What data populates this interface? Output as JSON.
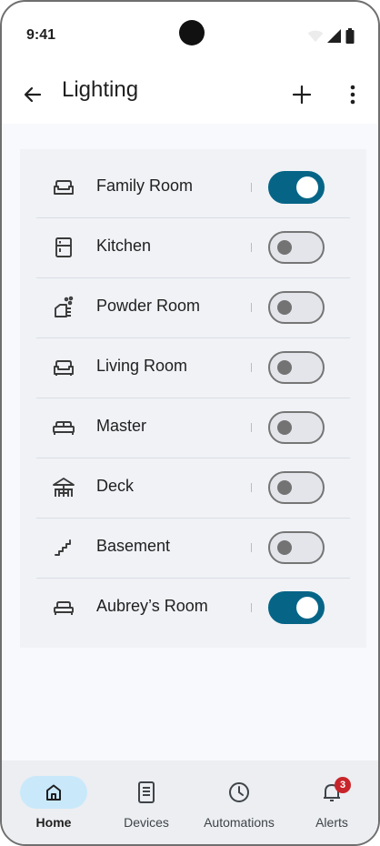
{
  "status_bar": {
    "time": "9:41",
    "icons": [
      "wifi-icon",
      "signal-icon",
      "battery-icon"
    ]
  },
  "app_bar": {
    "title": "Lighting",
    "back_icon": "arrow-back-icon",
    "add_icon": "add-icon",
    "more_icon": "more-vert-icon"
  },
  "rooms": [
    {
      "label": "Family Room",
      "icon": "sofa-icon",
      "on": true
    },
    {
      "label": "Kitchen",
      "icon": "fridge-icon",
      "on": false
    },
    {
      "label": "Powder Room",
      "icon": "sink-icon",
      "on": false
    },
    {
      "label": "Living Room",
      "icon": "sofa-icon",
      "on": false
    },
    {
      "label": "Master",
      "icon": "bed-icon",
      "on": false
    },
    {
      "label": "Deck",
      "icon": "deck-icon",
      "on": false
    },
    {
      "label": "Basement",
      "icon": "stairs-icon",
      "on": false
    },
    {
      "label": "Aubrey’s Room",
      "icon": "bed-icon",
      "on": true
    }
  ],
  "nav": {
    "items": [
      {
        "label": "Home",
        "icon": "home-icon",
        "active": true
      },
      {
        "label": "Devices",
        "icon": "device-icon",
        "active": false
      },
      {
        "label": "Automations",
        "icon": "clock-icon",
        "active": false
      },
      {
        "label": "Alerts",
        "icon": "bell-icon",
        "active": false,
        "badge": "3"
      }
    ]
  },
  "colors": {
    "toggle_on": "#066587",
    "toggle_off_track": "#e3e5ea",
    "nav_active_pill": "#c9e9fb",
    "badge": "#c8252b"
  }
}
